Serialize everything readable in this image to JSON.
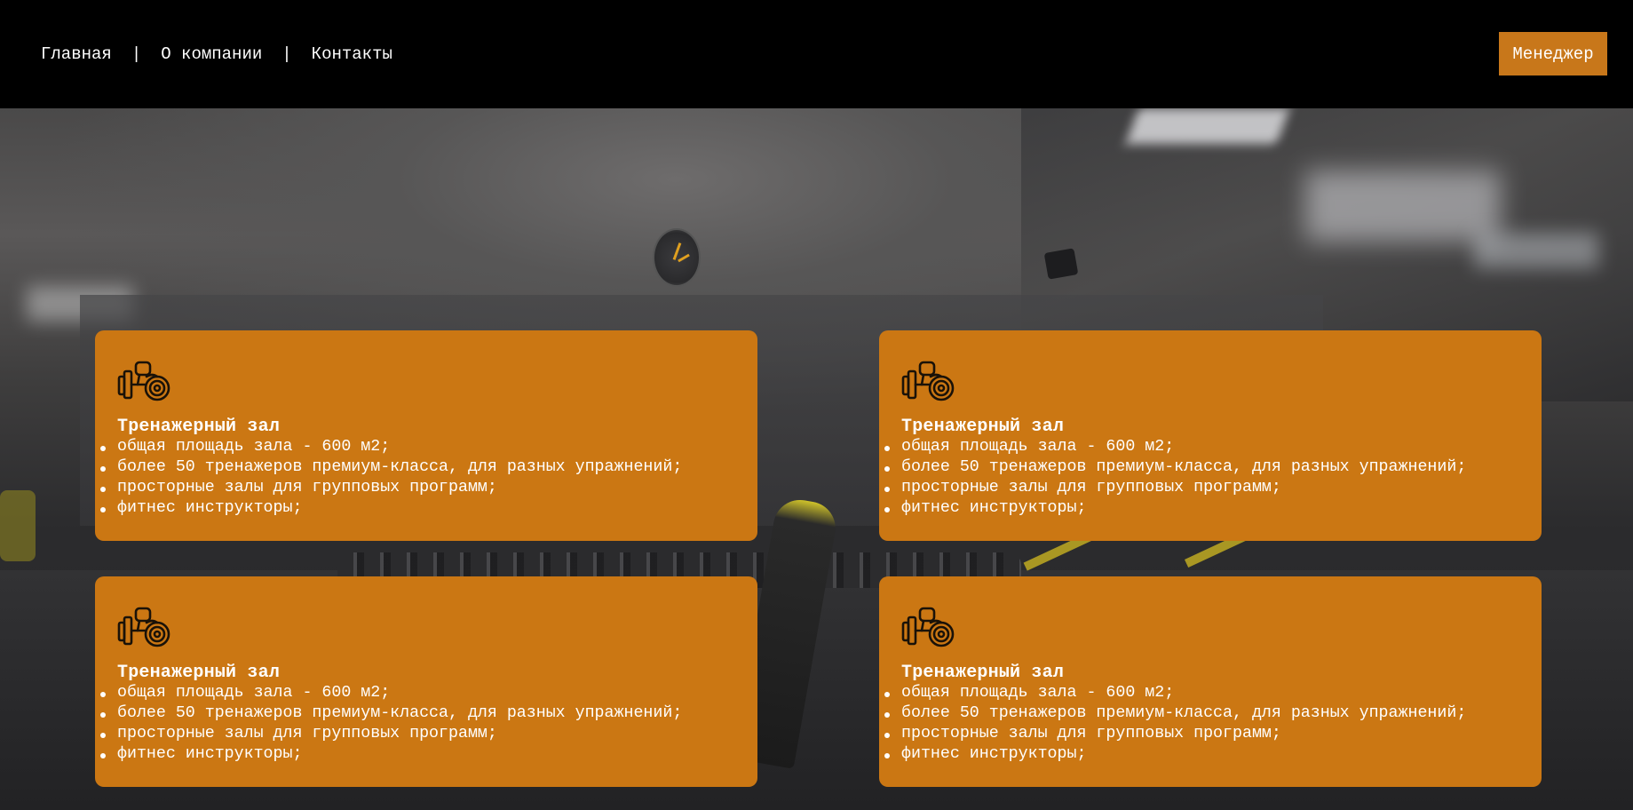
{
  "header": {
    "nav": [
      {
        "label": "Главная"
      },
      {
        "label": "О компании"
      },
      {
        "label": "Контакты"
      }
    ],
    "separator": "|",
    "manager_button": "Менеджер"
  },
  "colors": {
    "accent": "#cb7713",
    "header_bg": "#000000",
    "text": "#ffffff"
  },
  "cards": [
    {
      "icon": "dumbbell-icon",
      "title": "Тренажерный зал",
      "items": [
        "общая площадь зала - 600 м2;",
        "более 50 тренажеров премиум-класса, для разных упражнений;",
        "просторные залы для групповых программ;",
        "фитнес инструкторы;"
      ]
    },
    {
      "icon": "dumbbell-icon",
      "title": "Тренажерный зал",
      "items": [
        "общая площадь зала - 600 м2;",
        "более 50 тренажеров премиум-класса, для разных упражнений;",
        "просторные залы для групповых программ;",
        "фитнес инструкторы;"
      ]
    },
    {
      "icon": "dumbbell-icon",
      "title": "Тренажерный зал",
      "items": [
        "общая площадь зала - 600 м2;",
        "более 50 тренажеров премиум-класса, для разных упражнений;",
        "просторные залы для групповых программ;",
        "фитнес инструкторы;"
      ]
    },
    {
      "icon": "dumbbell-icon",
      "title": "Тренажерный зал",
      "items": [
        "общая площадь зала - 600 м2;",
        "более 50 тренажеров премиум-класса, для разных упражнений;",
        "просторные залы для групповых программ;",
        "фитнес инструкторы;"
      ]
    }
  ]
}
